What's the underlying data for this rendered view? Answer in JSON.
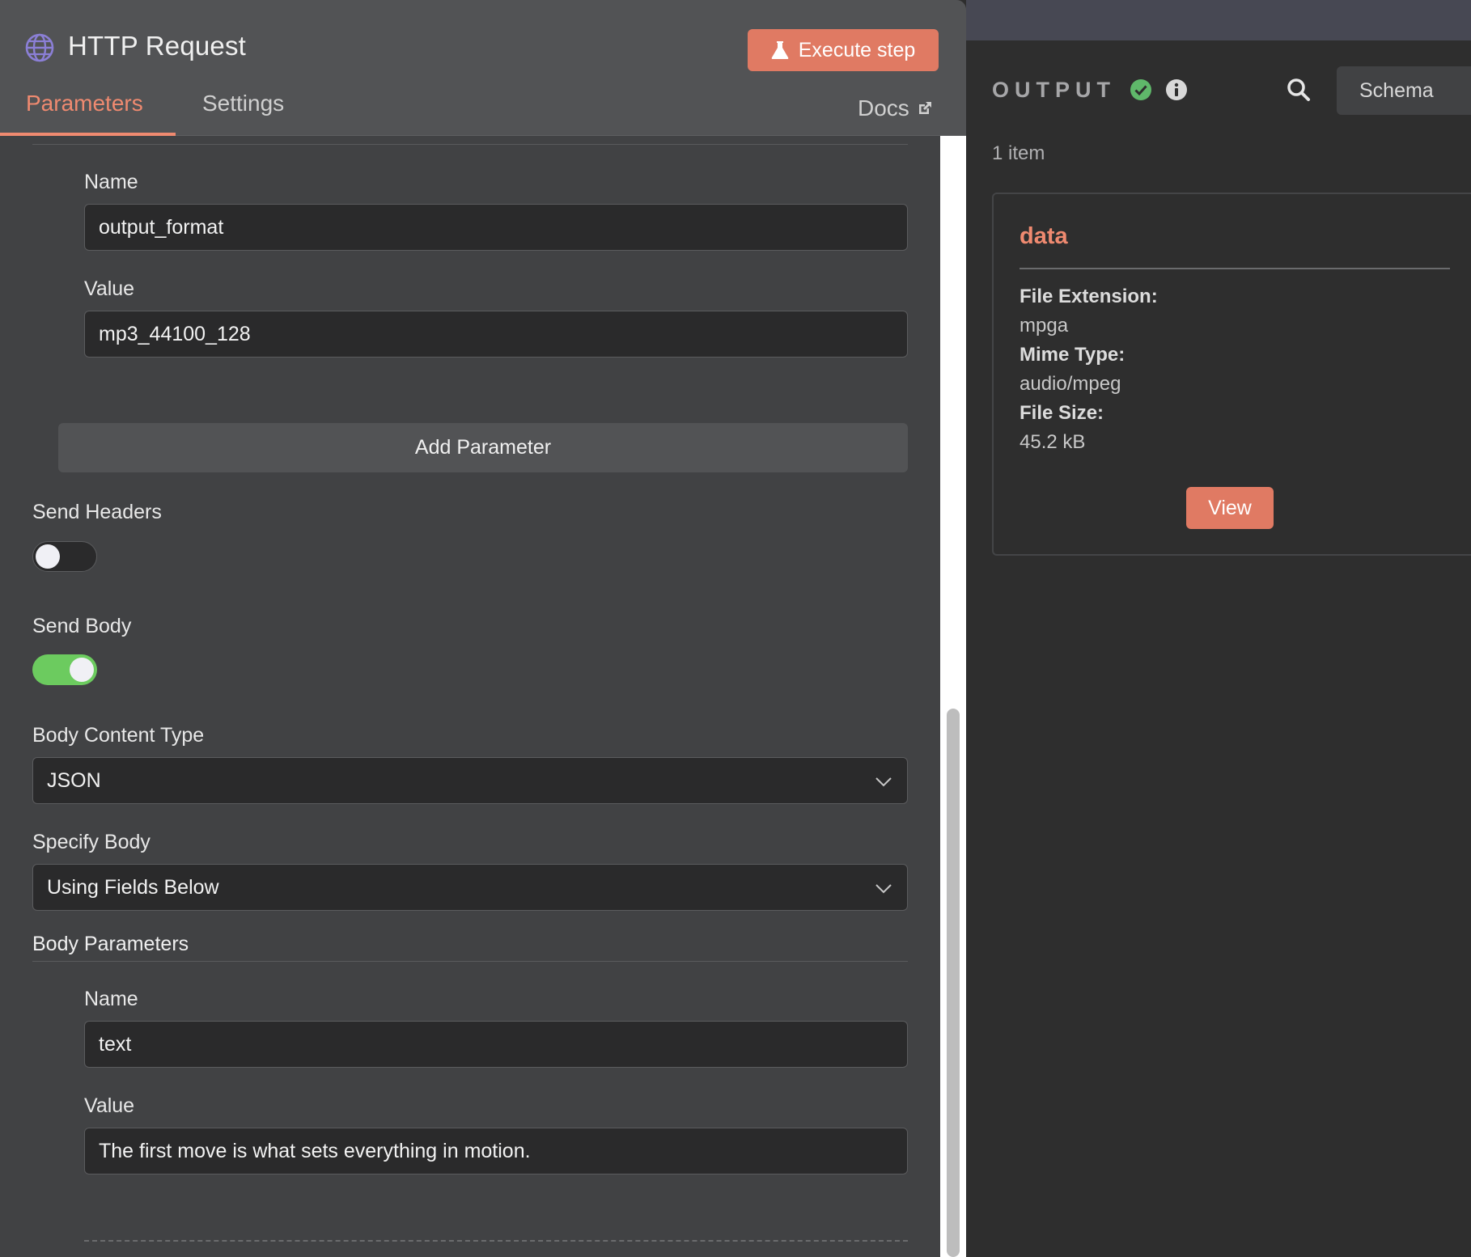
{
  "header": {
    "title": "HTTP Request",
    "execute_label": "Execute step",
    "tabs": [
      {
        "label": "Parameters",
        "active": true
      },
      {
        "label": "Settings",
        "active": false
      }
    ],
    "docs_label": "Docs"
  },
  "query_param": {
    "name_label": "Name",
    "name_value": "output_format",
    "value_label": "Value",
    "value_value": "mp3_44100_128",
    "add_label": "Add Parameter"
  },
  "send_headers": {
    "label": "Send Headers",
    "enabled": false
  },
  "send_body": {
    "label": "Send Body",
    "enabled": true
  },
  "body_content_type": {
    "label": "Body Content Type",
    "value": "JSON"
  },
  "specify_body": {
    "label": "Specify Body",
    "value": "Using Fields Below"
  },
  "body_parameters": {
    "label": "Body Parameters",
    "name_label": "Name",
    "name_value": "text",
    "value_label": "Value",
    "value_value": "The first move is what sets everything in motion."
  },
  "output": {
    "label": "OUTPUT",
    "schema_label": "Schema",
    "items_count": "1 item",
    "card": {
      "title": "data",
      "fields": [
        {
          "key": "File Extension:",
          "value": "mpga"
        },
        {
          "key": "Mime Type:",
          "value": "audio/mpeg"
        },
        {
          "key": "File Size:",
          "value": "45.2 kB"
        }
      ],
      "view_label": "View"
    }
  },
  "colors": {
    "accent": "#e07a63",
    "toggle_on": "#6ccb5f",
    "success": "#5fb86a"
  }
}
